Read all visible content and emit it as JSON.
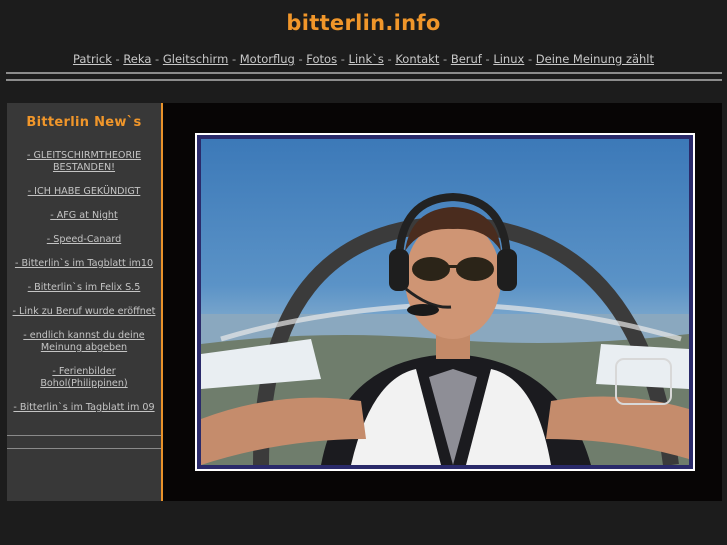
{
  "site": {
    "title": "bitterlin.info"
  },
  "nav": {
    "items": [
      "Patrick",
      "Reka",
      "Gleitschirm",
      "Motorflug",
      "Fotos",
      "Link`s",
      "Kontakt",
      "Beruf",
      "Linux",
      "Deine Meinung zählt"
    ],
    "separator": "-"
  },
  "sidebar": {
    "title": "Bitterlin New`s",
    "news": [
      "- GLEITSCHIRMTHEORIE BESTANDEN!",
      "- ICH HABE GEKÜNDIGT",
      "- AFG at Night",
      "- Speed-Canard",
      "- Bitterlin`s im Tagblatt im10",
      "- Bitterlin`s im Felix S.5",
      "- Link zu Beruf wurde eröffnet",
      "- endlich kannst du deine Meinung abgeben",
      "- Ferienbilder Bohol(Philippinen)",
      "- Bitterlin`s im Tagblatt im 09"
    ]
  },
  "colors": {
    "accent": "#f0962a",
    "background": "#1c1c1c",
    "sidebar_bg": "#383838",
    "main_bg": "#070505",
    "photo_border": "#2a2a6a"
  },
  "photo": {
    "subject": "pilot selfie in glider cockpit"
  }
}
